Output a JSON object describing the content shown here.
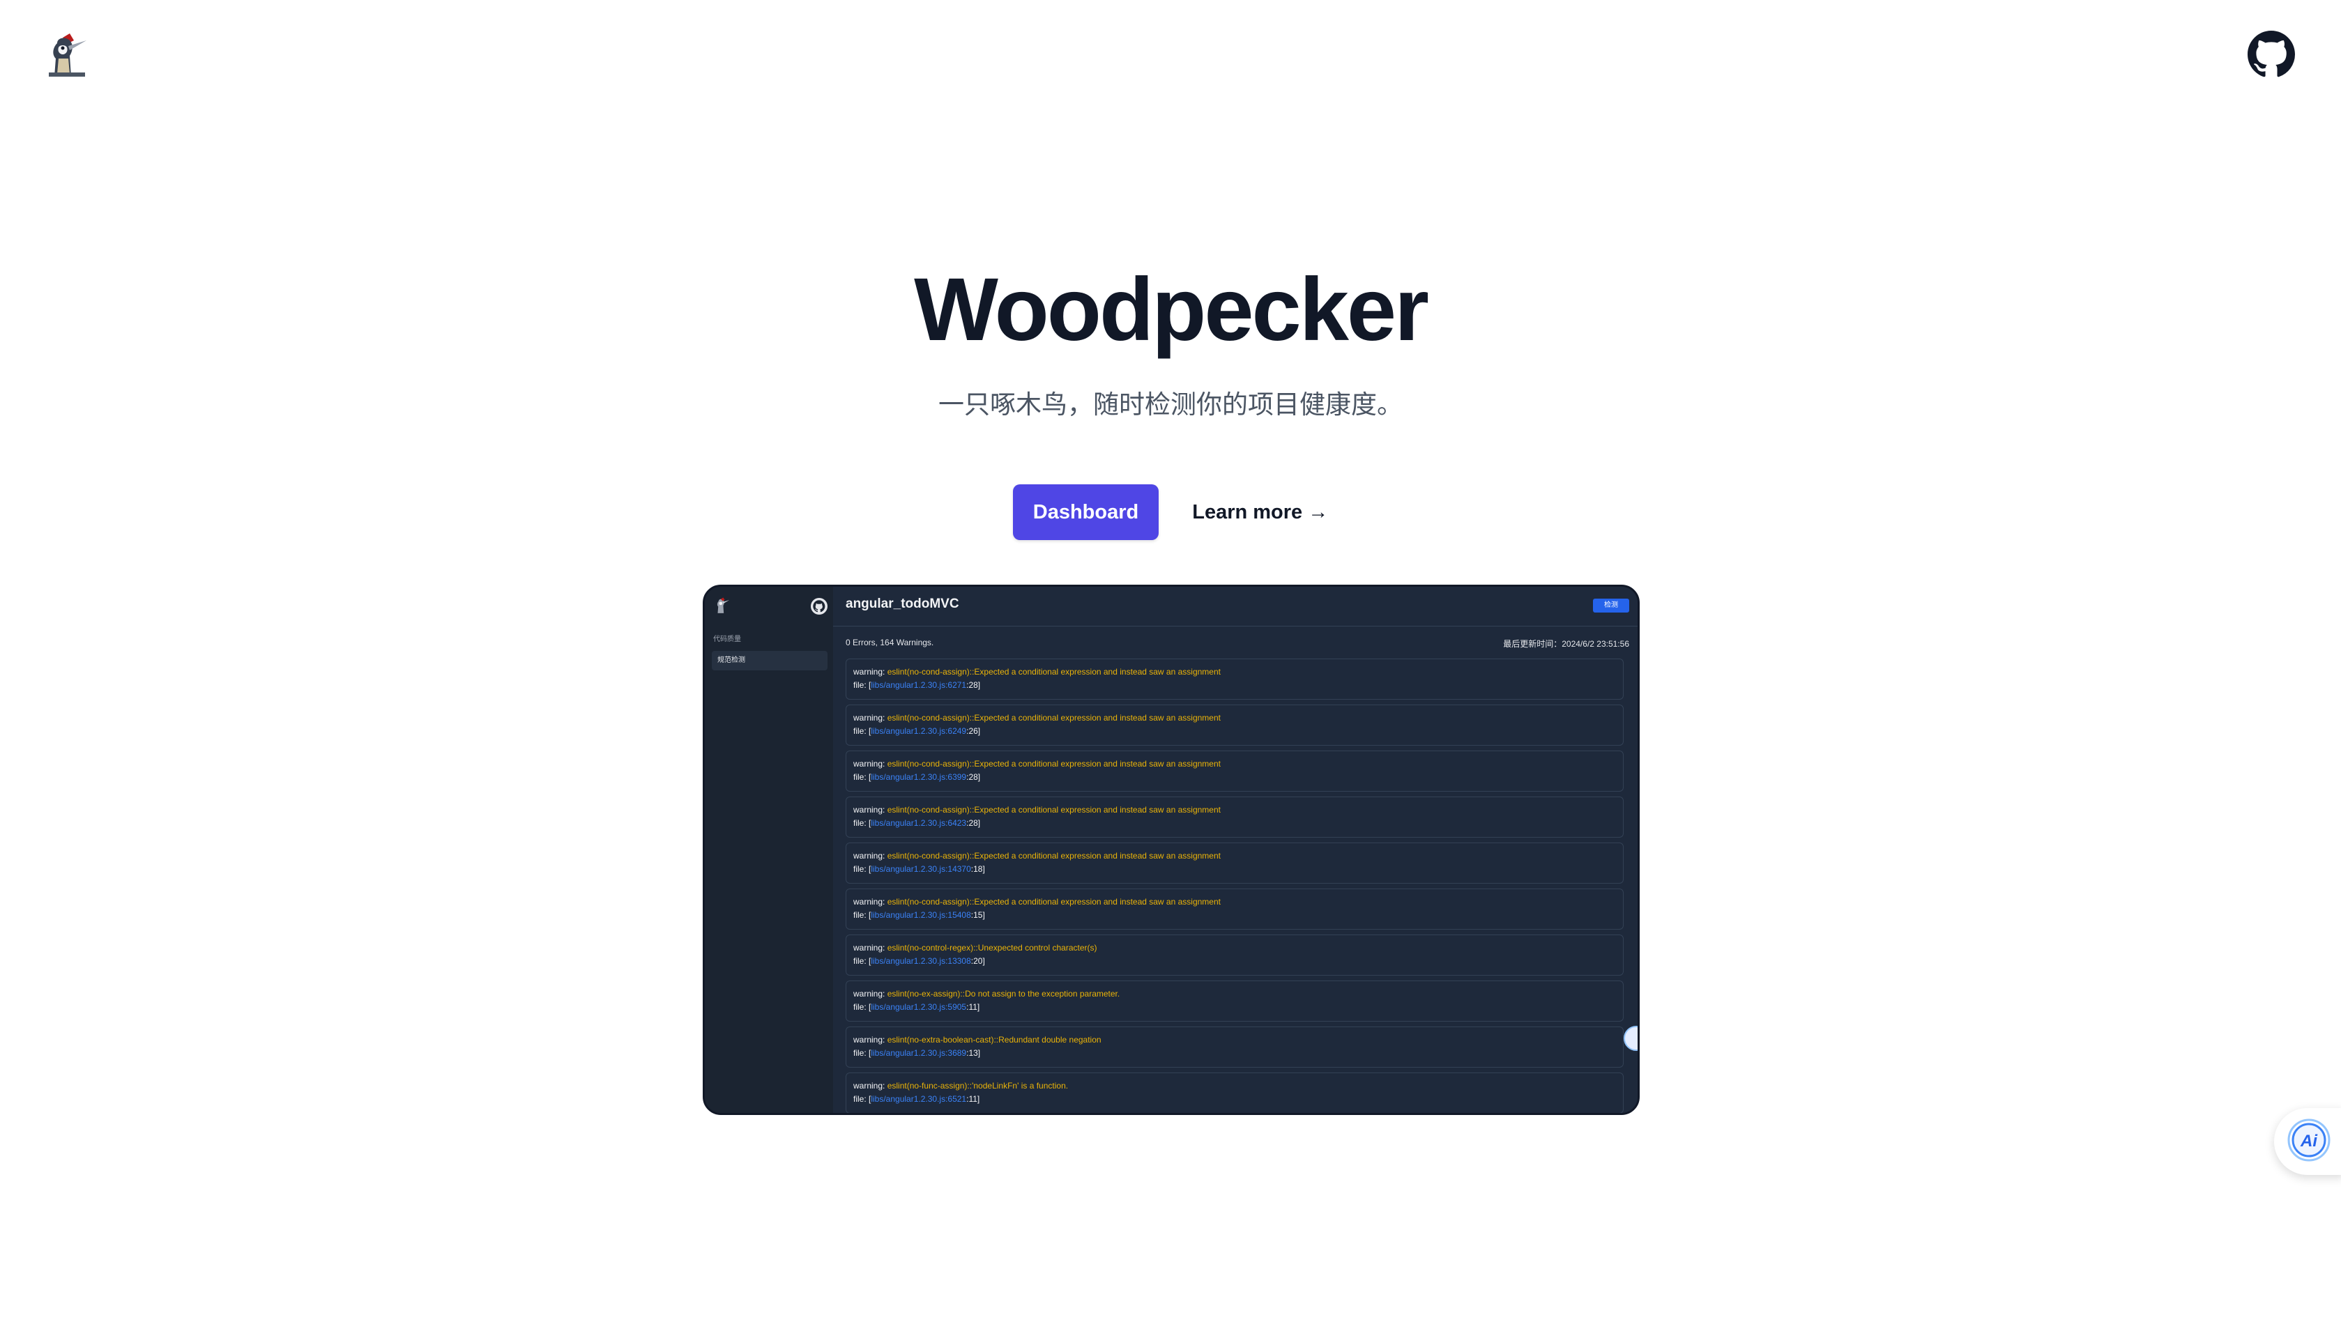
{
  "header": {
    "logo_icon": "woodpecker-logo-icon",
    "github_icon": "github-icon"
  },
  "hero": {
    "title": "Woodpecker",
    "subtitle": "一只啄木鸟，随时检测你的项目健康度。",
    "primary_button": "Dashboard",
    "secondary_button": "Learn more →"
  },
  "preview": {
    "sidebar": {
      "section_label": "代码质量",
      "item_label": "规范检测"
    },
    "project_title": "angular_todoMVC",
    "detect_button": "检测",
    "summary": "0 Errors, 164 Warnings.",
    "updated": "最后更新时间：2024/6/2 23:51:56",
    "issues": [
      {
        "level": "warning:",
        "message": "eslint(no-cond-assign)::Expected a conditional expression and instead saw an assignment",
        "file_prefix": "file: [",
        "file": "libs/angular1.2.30.js:6271",
        "line": ":28]"
      },
      {
        "level": "warning:",
        "message": "eslint(no-cond-assign)::Expected a conditional expression and instead saw an assignment",
        "file_prefix": "file: [",
        "file": "libs/angular1.2.30.js:6249",
        "line": ":26]"
      },
      {
        "level": "warning:",
        "message": "eslint(no-cond-assign)::Expected a conditional expression and instead saw an assignment",
        "file_prefix": "file: [",
        "file": "libs/angular1.2.30.js:6399",
        "line": ":28]"
      },
      {
        "level": "warning:",
        "message": "eslint(no-cond-assign)::Expected a conditional expression and instead saw an assignment",
        "file_prefix": "file: [",
        "file": "libs/angular1.2.30.js:6423",
        "line": ":28]"
      },
      {
        "level": "warning:",
        "message": "eslint(no-cond-assign)::Expected a conditional expression and instead saw an assignment",
        "file_prefix": "file: [",
        "file": "libs/angular1.2.30.js:14370",
        "line": ":18]"
      },
      {
        "level": "warning:",
        "message": "eslint(no-cond-assign)::Expected a conditional expression and instead saw an assignment",
        "file_prefix": "file: [",
        "file": "libs/angular1.2.30.js:15408",
        "line": ":15]"
      },
      {
        "level": "warning:",
        "message": "eslint(no-control-regex)::Unexpected control character(s)",
        "file_prefix": "file: [",
        "file": "libs/angular1.2.30.js:13308",
        "line": ":20]"
      },
      {
        "level": "warning:",
        "message": "eslint(no-ex-assign)::Do not assign to the exception parameter.",
        "file_prefix": "file: [",
        "file": "libs/angular1.2.30.js:5905",
        "line": ":11]"
      },
      {
        "level": "warning:",
        "message": "eslint(no-extra-boolean-cast)::Redundant double negation",
        "file_prefix": "file: [",
        "file": "libs/angular1.2.30.js:3689",
        "line": ":13]"
      },
      {
        "level": "warning:",
        "message": "eslint(no-func-assign)::'nodeLinkFn' is a function.",
        "file_prefix": "file: [",
        "file": "libs/angular1.2.30.js:6521",
        "line": ":11]"
      }
    ]
  },
  "ai_button": {
    "icon": "ai-assistant-icon",
    "label": "Ai"
  },
  "colors": {
    "primary": "#4f46e5",
    "preview_bg": "#1f2937",
    "warning_text": "#eab308",
    "link": "#3b82f6"
  }
}
